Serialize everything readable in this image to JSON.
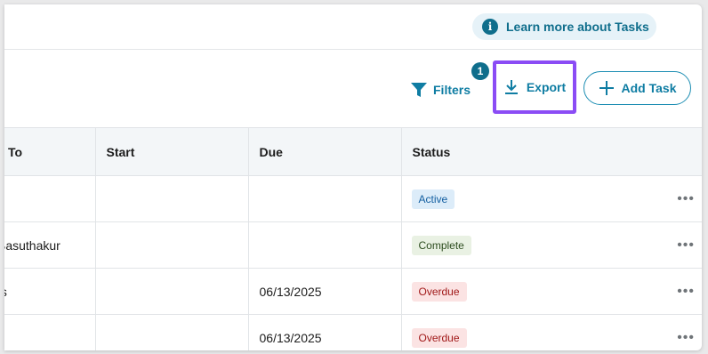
{
  "header": {
    "learn_more_label": "Learn more about Tasks",
    "info_icon": "i"
  },
  "toolbar": {
    "filters_label": "Filters",
    "filter_count": "1",
    "export_label": "Export",
    "add_task_label": "Add Task"
  },
  "table": {
    "columns": [
      "To",
      "Start",
      "Due",
      "Status"
    ],
    "rows": [
      {
        "assigned": ":",
        "start": "",
        "due": "",
        "status": "Active"
      },
      {
        "assigned": "Basuthakur",
        "start": "",
        "due": "",
        "status": "Complete"
      },
      {
        "assigned": "ts",
        "start": "",
        "due": "06/13/2025",
        "status": "Overdue"
      },
      {
        "assigned": ":",
        "start": "",
        "due": "06/13/2025",
        "status": "Overdue"
      }
    ],
    "row_menu": "•••"
  },
  "colors": {
    "accent": "#0f7da3",
    "highlight": "#8b4cf5",
    "badge_fill": "#0f6e8c"
  }
}
